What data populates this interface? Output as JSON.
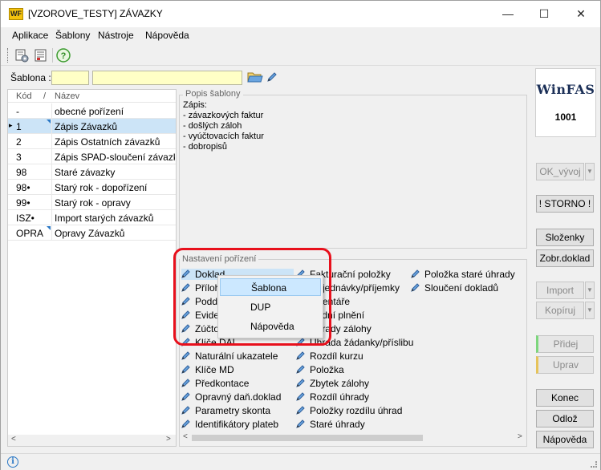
{
  "window": {
    "title": "[VZOROVE_TESTY] ZÁVAZKY",
    "logo_text": "WF",
    "controls": {
      "minimize": "—",
      "maximize": "☐",
      "close": "✕"
    }
  },
  "menu": [
    "Aplikace",
    "Šablony",
    "Nástroje",
    "Nápověda"
  ],
  "toolbar": {
    "help_icon": "?"
  },
  "filter": {
    "label": "Šablona :",
    "code_value": "",
    "name_value": ""
  },
  "list": {
    "headers": {
      "code": "Kód",
      "sort": "/",
      "name": "Název"
    },
    "rows": [
      {
        "code": "-",
        "name": "obecné pořízení",
        "mark": false
      },
      {
        "code": "1",
        "name": "Zápis Závazků",
        "mark": true,
        "selected": true
      },
      {
        "code": "2",
        "name": "Zápis Ostatních závazků",
        "mark": false
      },
      {
        "code": "3",
        "name": "Zápis SPAD-sloučení závazků",
        "mark": false
      },
      {
        "code": "98",
        "name": "Staré závazky",
        "mark": false
      },
      {
        "code": "98•",
        "name": "Starý rok - dopořízení",
        "mark": false
      },
      {
        "code": "99•",
        "name": "Starý rok - opravy",
        "mark": false
      },
      {
        "code": "ISZ•",
        "name": "Import starých závazků",
        "mark": false
      },
      {
        "code": "OPRA",
        "name": "Opravy Závazků",
        "mark": true
      }
    ],
    "selected_indicator": "▸"
  },
  "popis": {
    "legend": "Popis šablony",
    "text": "Zápis:\n- závazkových faktur\n- došlých záloh\n- vyúčtovacích faktur\n- dobropisů"
  },
  "nastaveni": {
    "legend": "Nastavení pořízení",
    "col1": [
      "Doklad",
      "Přílohy",
      "Poddoklady",
      "Evidence",
      "Zúčtování",
      "Klíče DAL",
      "Naturální ukazatele",
      "Klíče MD",
      "Předkontace",
      "Opravný daň.doklad",
      "Parametry skonta",
      "Identifikátory plateb"
    ],
    "col2": [
      "Fakturační položky",
      "Objednávky/příjemky",
      "Inventáře",
      "Řádní plnění",
      "Úhrady zálohy",
      "Úhrada žádanky/příslibu",
      "Rozdíl kurzu",
      "Položka",
      "Zbytek zálohy",
      "Rozdíl úhrady",
      "Položky rozdílu úhrad",
      "Staré úhrady"
    ],
    "col3": [
      "Položka staré úhrady",
      "Sloučení dokladů"
    ]
  },
  "context_menu": [
    "Šablona",
    "DUP",
    "Nápověda"
  ],
  "brand": {
    "logo": "WinFAS",
    "code": "1001"
  },
  "buttons": {
    "ok_vyvoj": "OK_vývoj",
    "storno": "! STORNO !",
    "slozenky": "Složenky",
    "zobr_doklad": "Zobr.doklad",
    "import": "Import",
    "kopiruj": "Kopíruj",
    "pridej": "Přidej",
    "uprav": "Uprav",
    "konec": "Konec",
    "odloz": "Odlož",
    "napoveda": "Nápověda",
    "drop": "▼"
  },
  "status": {
    "info_icon": "i"
  },
  "colors": {
    "selection": "#cce4f7",
    "highlight": "#e8101c",
    "input_bg": "#ffffc6"
  }
}
